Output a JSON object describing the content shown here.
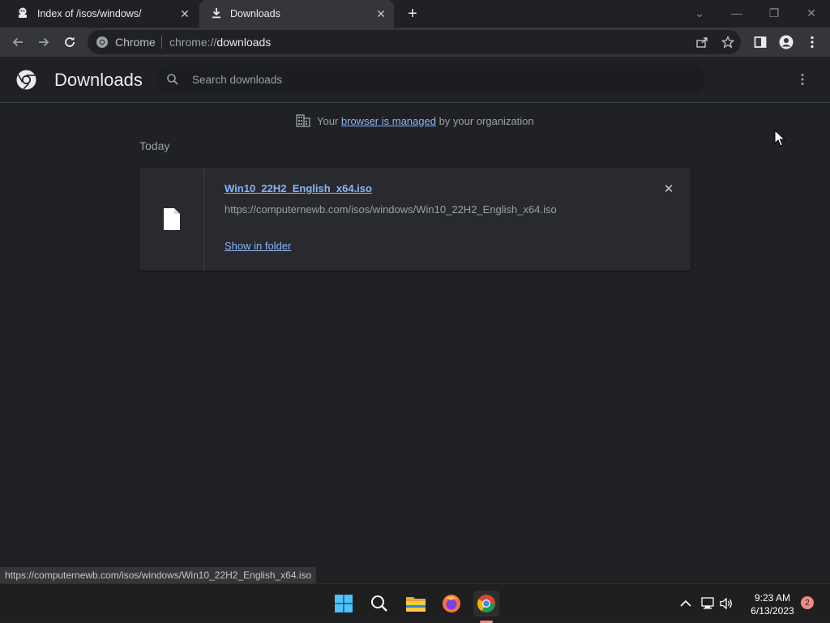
{
  "tabs": [
    {
      "title": "Index of /isos/windows/",
      "close": "✕"
    },
    {
      "title": "Downloads",
      "close": "✕"
    }
  ],
  "new_tab": "+",
  "window_controls": {
    "tab_search": "⌄",
    "minimize": "—",
    "restore": "❐",
    "close": "✕"
  },
  "omnibox": {
    "chip": "Chrome",
    "url_scheme": "chrome://",
    "url_host": "downloads"
  },
  "downloads_page": {
    "title": "Downloads",
    "search_placeholder": "Search downloads",
    "managed_prefix": "Your ",
    "managed_link": "browser is managed",
    "managed_suffix": " by your organization",
    "section_date": "Today",
    "items": [
      {
        "filename": "Win10_22H2_English_x64.iso",
        "url": "https://computernewb.com/isos/windows/Win10_22H2_English_x64.iso",
        "action": "Show in folder",
        "remove": "✕"
      }
    ]
  },
  "status_bar": "https://computernewb.com/isos/windows/Win10_22H2_English_x64.iso",
  "taskbar": {
    "time": "9:23 AM",
    "date": "6/13/2023",
    "notification_count": "2"
  },
  "colors": {
    "accent": "#8ab4f8",
    "background": "#202124",
    "toolbar": "#35363a"
  }
}
